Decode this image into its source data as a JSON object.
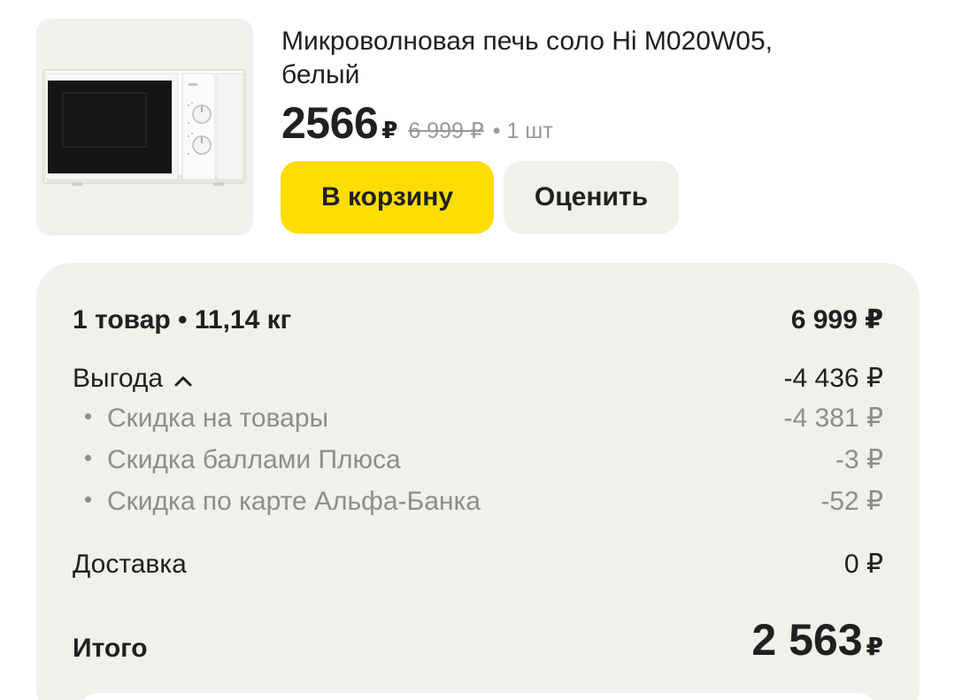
{
  "product": {
    "image_alt": "microwave-image",
    "title_line1": "Микроволновая печь соло Hi M020W05,",
    "title_line2": "белый",
    "price": "2566",
    "currency": "₽",
    "old_price": "6 999 ₽",
    "quantity": "• 1 шт",
    "add_to_cart_label": "В корзину",
    "rate_label": "Оценить"
  },
  "summary": {
    "items_label": "1 товар • 11,14 кг",
    "items_value": "6 999 ₽",
    "benefit_label": "Выгода",
    "benefit_value": "-4 436 ₽",
    "discounts": [
      {
        "label": "Скидка на товары",
        "value": "-4 381 ₽"
      },
      {
        "label": "Скидка баллами Плюса",
        "value": "-3 ₽"
      },
      {
        "label": "Скидка по карте Альфа-Банка",
        "value": "-52 ₽"
      }
    ],
    "delivery_label": "Доставка",
    "delivery_value": "0 ₽",
    "total_label": "Итого",
    "total_value": "2 563",
    "total_currency": "₽"
  },
  "colors": {
    "accent": "#ffdd00",
    "card_bg": "#f1f0ed",
    "text": "#21201f",
    "muted": "#8e8d8a"
  },
  "icons": {
    "benefit_toggle": "chevron-up-icon"
  }
}
